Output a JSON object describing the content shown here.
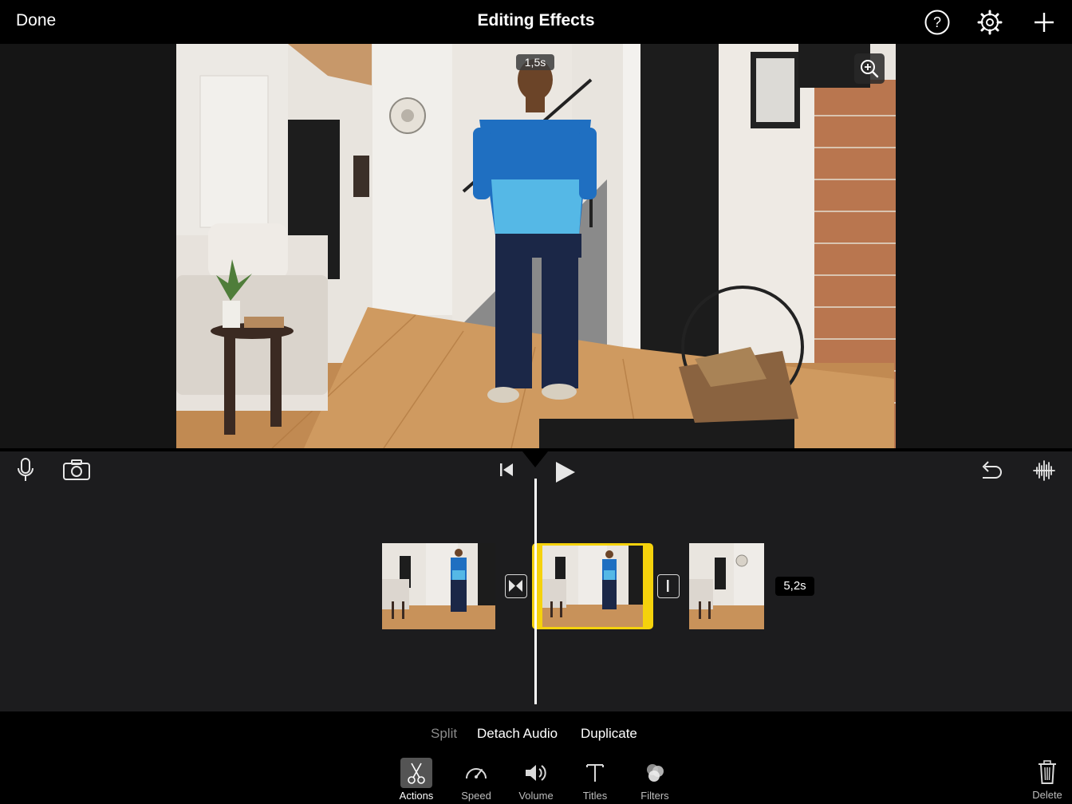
{
  "header": {
    "done_label": "Done",
    "title": "Editing Effects"
  },
  "viewer": {
    "time_badge": "1,5s"
  },
  "timeline": {
    "duration_badge": "5,2s"
  },
  "actions": {
    "split": "Split",
    "detach_audio": "Detach Audio",
    "duplicate": "Duplicate"
  },
  "tools": {
    "actions": "Actions",
    "speed": "Speed",
    "volume": "Volume",
    "titles": "Titles",
    "filters": "Filters",
    "delete": "Delete"
  },
  "colors": {
    "accent_selected_clip": "#f5d20c",
    "timeline_bg": "#1c1c1e",
    "selected_tool_bg": "#545454"
  },
  "icons": [
    "help-icon",
    "settings-gear-icon",
    "add-plus-icon",
    "zoom-in-icon",
    "microphone-icon",
    "camera-icon",
    "skip-to-start-icon",
    "play-icon",
    "undo-icon",
    "audio-waveform-icon",
    "scissors-icon",
    "speedometer-icon",
    "speaker-icon",
    "text-t-icon",
    "filters-circles-icon",
    "trash-icon"
  ]
}
